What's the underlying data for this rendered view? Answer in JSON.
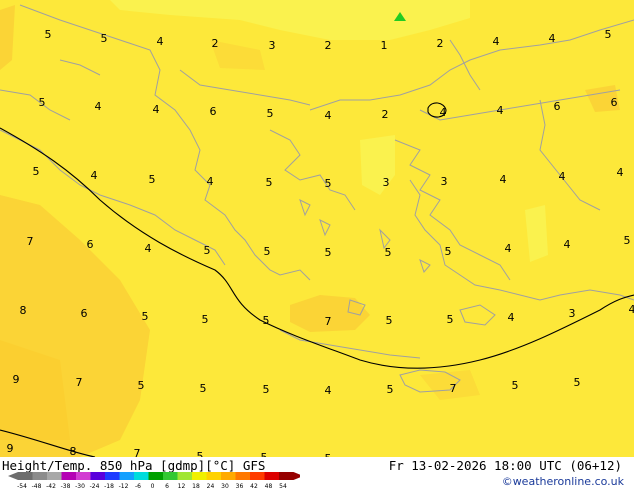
{
  "footer": {
    "title": "Height/Temp. 850 hPa [gdmp][°C] GFS",
    "valid": "Fr 13-02-2026 18:00 UTC (06+12)",
    "credit": "©weatheronline.co.uk"
  },
  "colorscale": {
    "labels": [
      "-54",
      "-48",
      "-42",
      "-38",
      "-30",
      "-24",
      "-18",
      "-12",
      "-6",
      "0",
      "6",
      "12",
      "18",
      "24",
      "30",
      "36",
      "42",
      "48",
      "54"
    ],
    "colors": [
      "#6e6e6e",
      "#8c8c8c",
      "#a8a8a8",
      "#b400b4",
      "#d23cd2",
      "#5a00dc",
      "#1e3cff",
      "#14a0ff",
      "#00dcdc",
      "#00a000",
      "#32c832",
      "#a0e632",
      "#f0f000",
      "#ffd200",
      "#ffaa00",
      "#ff7800",
      "#ff3c00",
      "#dc0000",
      "#960000"
    ]
  },
  "colors": {
    "field_main": "#fde83a",
    "field_warm": "#fbcf30",
    "field_cool": "#faf050",
    "coast": "#a0a0a0",
    "contour": "#000000",
    "label": "#000000",
    "marker": "#22cc22"
  },
  "labels": [
    "5",
    "5",
    "4",
    "2",
    "3",
    "2",
    "1",
    "2",
    "4",
    "4",
    "5",
    "5",
    "4",
    "4",
    "6",
    "5",
    "4",
    "2",
    "4",
    "4",
    "6",
    "6",
    "5",
    "4",
    "5",
    "4",
    "5",
    "5",
    "3",
    "3",
    "4",
    "4",
    "4",
    "7",
    "6",
    "4",
    "5",
    "5",
    "5",
    "5",
    "5",
    "4",
    "4",
    "5",
    "8",
    "6",
    "5",
    "5",
    "5",
    "7",
    "5",
    "5",
    "4",
    "3",
    "4",
    "9",
    "7",
    "5",
    "5",
    "5",
    "4",
    "5",
    "7",
    "5",
    "5",
    "9",
    "8",
    "7",
    "5",
    "5",
    "5"
  ],
  "contour_label": "4"
}
